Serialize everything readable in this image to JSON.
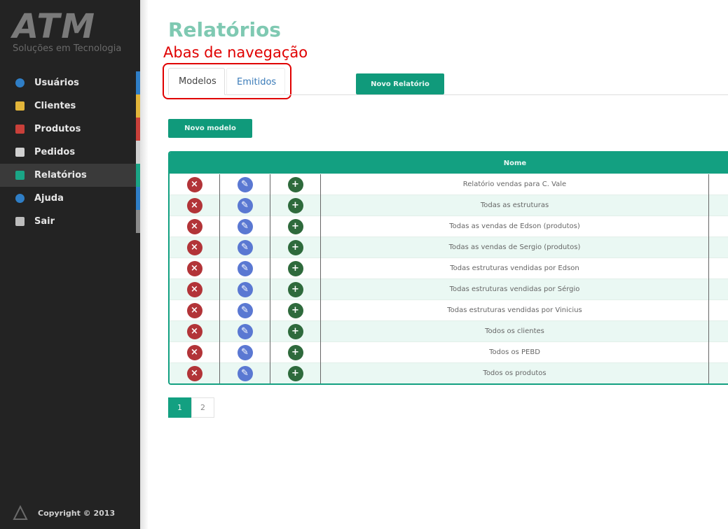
{
  "sidebar": {
    "logo_text": "ATM",
    "logo_tagline": "Soluções em Tecnologia",
    "items": [
      {
        "label": "Usuários",
        "icon": "home-icon",
        "icon_color": "#2f7ec6",
        "stripe_color": "#2f7ec6",
        "active": false
      },
      {
        "label": "Clientes",
        "icon": "mail-icon",
        "icon_color": "#e2b53a",
        "stripe_color": "#e2b53a",
        "active": false
      },
      {
        "label": "Produtos",
        "icon": "box-icon",
        "icon_color": "#c9403a",
        "stripe_color": "#c9403a",
        "active": false
      },
      {
        "label": "Pedidos",
        "icon": "document-icon",
        "icon_color": "#d0d0d0",
        "stripe_color": "#d0d0d0",
        "active": false
      },
      {
        "label": "Relatórios",
        "icon": "chart-icon",
        "icon_color": "#1aa586",
        "stripe_color": "#1aa586",
        "active": true
      },
      {
        "label": "Ajuda",
        "icon": "help-icon",
        "icon_color": "#2f7ec6",
        "stripe_color": "#2f7ec6",
        "active": false
      },
      {
        "label": "Sair",
        "icon": "exit-icon",
        "icon_color": "#bdbdbd",
        "stripe_color": "#8a8a8a",
        "active": false
      }
    ],
    "footer": "Copyright © 2013"
  },
  "main": {
    "title": "Relatórios",
    "annotation": "Abas de navegação",
    "tabs": [
      {
        "label": "Modelos",
        "active": true
      },
      {
        "label": "Emitidos",
        "active": false
      }
    ],
    "new_report_button": "Novo Relatório",
    "new_model_button": "Novo modelo",
    "table": {
      "column_name": "Nome",
      "rows": [
        "Relatório vendas para C. Vale",
        "Todas as estruturas",
        "Todas as vendas de Edson (produtos)",
        "Todas as vendas de Sergio (produtos)",
        "Todas estruturas vendidas por Edson",
        "Todas estruturas vendidas por Sérgio",
        "Todas estruturas vendidas por Vinicius",
        "Todos os clientes",
        "Todos os PEBD",
        "Todos os produtos"
      ]
    },
    "pagination": [
      "1",
      "2"
    ],
    "current_page": "1"
  },
  "colors": {
    "accent": "#13a081",
    "sidebar_bg": "#232323",
    "title": "#7fc9b2",
    "annotation": "#e00000",
    "delete": "#b23438",
    "edit": "#5a78d2",
    "add": "#2e6a3c"
  }
}
